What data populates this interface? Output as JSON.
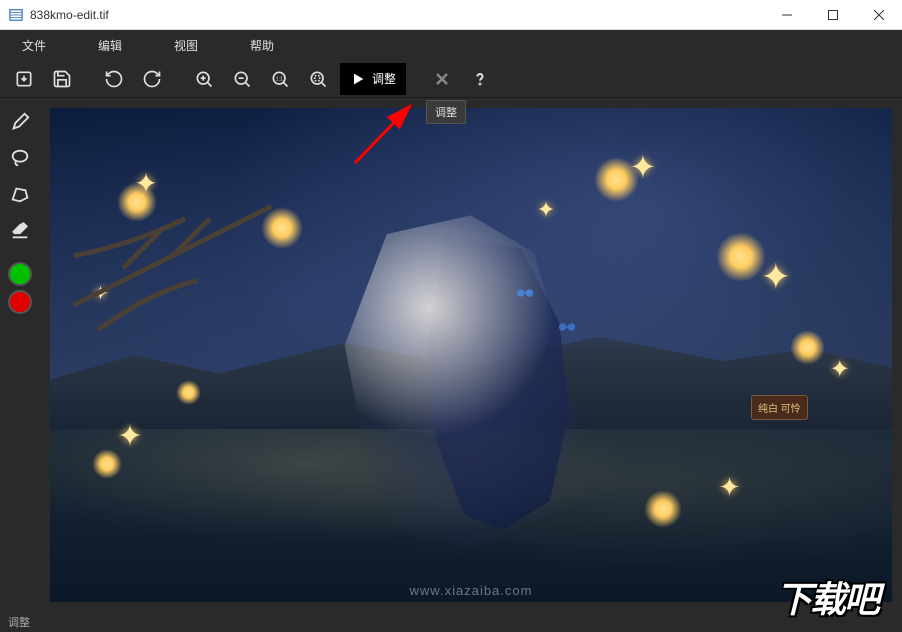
{
  "titlebar": {
    "title": "838kmo-edit.tif"
  },
  "menubar": {
    "file": "文件",
    "edit": "编辑",
    "view": "视图",
    "help": "帮助"
  },
  "toolbar": {
    "adjust_label": "调整",
    "tooltip_text": "调整"
  },
  "tools": {
    "color_green": "#00c000",
    "color_red": "#e00000"
  },
  "image": {
    "corner_badge": "纯白\n可怜",
    "watermark_url": "www.xiazaiba.com"
  },
  "overlay": {
    "logo_text": "下载吧"
  },
  "statusbar": {
    "text": "调整"
  }
}
